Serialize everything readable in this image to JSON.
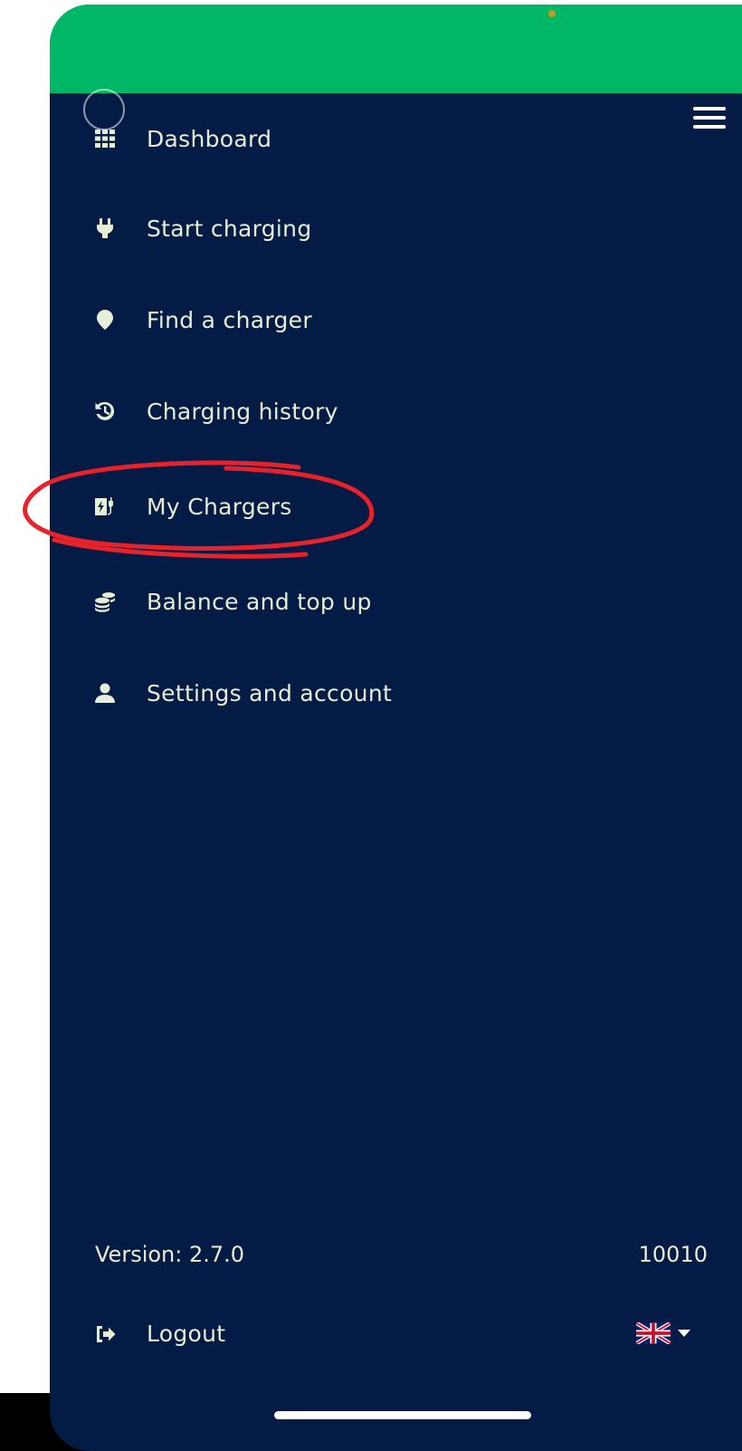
{
  "menu": {
    "items": [
      {
        "label": "Dashboard",
        "icon": "grid-icon"
      },
      {
        "label": "Start charging",
        "icon": "plug-icon"
      },
      {
        "label": "Find a charger",
        "icon": "map-pin-icon"
      },
      {
        "label": "Charging history",
        "icon": "history-icon"
      },
      {
        "label": "My Chargers",
        "icon": "charging-station-icon"
      },
      {
        "label": "Balance and top up",
        "icon": "coins-icon"
      },
      {
        "label": "Settings and account",
        "icon": "user-icon"
      }
    ]
  },
  "footer": {
    "version": "Version: 2.7.0",
    "build": "10010",
    "logout_label": "Logout",
    "language": "uk-flag-icon"
  },
  "colors": {
    "topbar": "#00b767",
    "drawer_background": "#041b45",
    "text": "#e6eed6",
    "annotation": "#e8222a"
  }
}
